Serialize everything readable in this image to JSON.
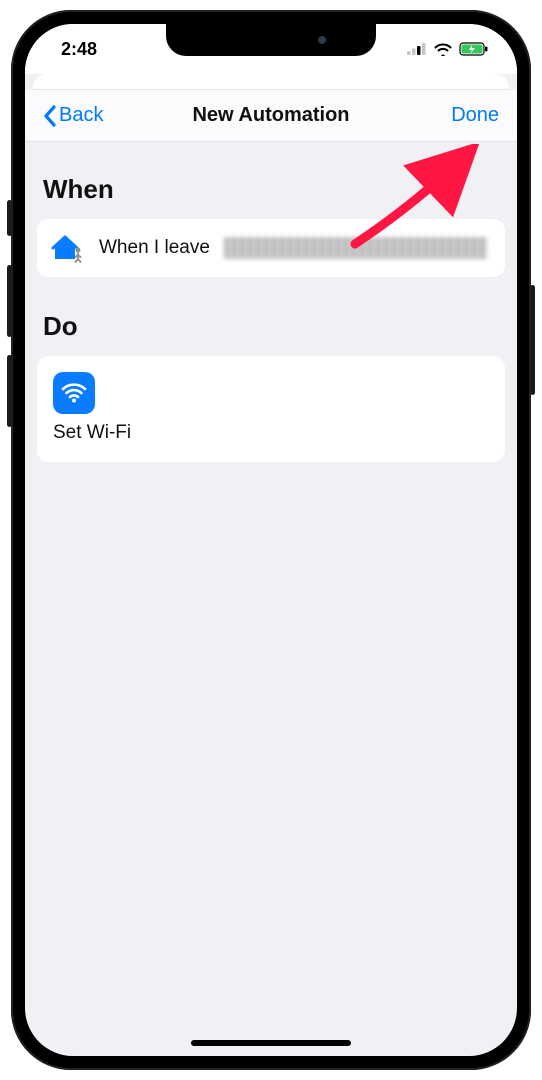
{
  "status": {
    "time": "2:48"
  },
  "nav": {
    "back": "Back",
    "title": "New Automation",
    "done": "Done"
  },
  "sections": {
    "when_header": "When",
    "when_text": "When I leave",
    "do_header": "Do",
    "do_action": "Set Wi-Fi"
  },
  "colors": {
    "accent": "#007aff"
  }
}
